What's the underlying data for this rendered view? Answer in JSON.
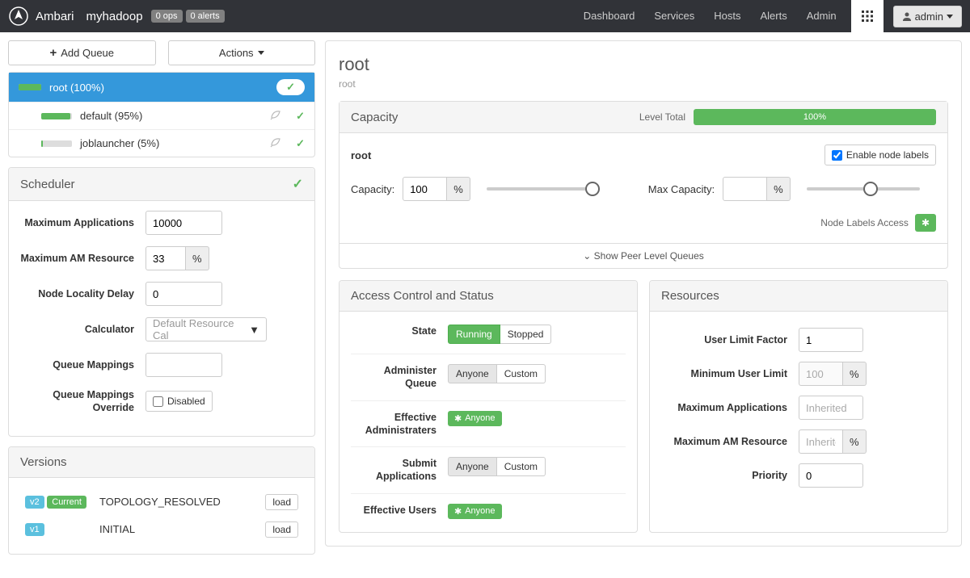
{
  "topnav": {
    "brand": "Ambari",
    "cluster": "myhadoop",
    "ops_badge": "0 ops",
    "alerts_badge": "0 alerts",
    "links": [
      "Dashboard",
      "Services",
      "Hosts",
      "Alerts",
      "Admin"
    ],
    "admin_btn": "admin"
  },
  "sidebar": {
    "add_queue": "Add Queue",
    "actions": "Actions",
    "queues": [
      {
        "label": "root (100%)",
        "fill": 100,
        "barw": 28,
        "indent": 0,
        "selected": true,
        "leaf": false
      },
      {
        "label": "default (95%)",
        "fill": 95,
        "barw": 38,
        "indent": 28,
        "selected": false,
        "leaf": true
      },
      {
        "label": "joblauncher (5%)",
        "fill": 5,
        "barw": 38,
        "indent": 28,
        "selected": false,
        "leaf": true
      }
    ]
  },
  "scheduler": {
    "title": "Scheduler",
    "max_apps_label": "Maximum Applications",
    "max_apps": "10000",
    "max_am_label": "Maximum AM Resource",
    "max_am": "33",
    "locality_label": "Node Locality Delay",
    "locality": "0",
    "calc_label": "Calculator",
    "calc": "Default Resource Cal",
    "qm_label": "Queue Mappings",
    "qm": "",
    "qmo_label": "Queue Mappings Override",
    "qmo": "Disabled"
  },
  "versions": {
    "title": "Versions",
    "rows": [
      {
        "tag": "v2",
        "current": "Current",
        "name": "TOPOLOGY_RESOLVED",
        "btn": "load"
      },
      {
        "tag": "v1",
        "current": "",
        "name": "INITIAL",
        "btn": "load"
      }
    ]
  },
  "main": {
    "title": "root",
    "breadcrumb": "root",
    "capacity": {
      "heading": "Capacity",
      "level_total_label": "Level Total",
      "level_total_pct": "100%",
      "queue_name": "root",
      "enable_labels": "Enable node labels",
      "cap_label": "Capacity:",
      "cap_val": "100",
      "maxcap_label": "Max Capacity:",
      "maxcap_val": "",
      "node_access": "Node Labels Access",
      "peer": "Show Peer Level Queues"
    },
    "acs": {
      "heading": "Access Control and Status",
      "state_label": "State",
      "state_running": "Running",
      "state_stopped": "Stopped",
      "admin_q_label": "Administer Queue",
      "anyone": "Anyone",
      "custom": "Custom",
      "eff_admin_label": "Effective Administraters",
      "anyone_tag": "Anyone",
      "submit_label": "Submit Applications",
      "eff_users_label": "Effective Users"
    },
    "res": {
      "heading": "Resources",
      "ulf_label": "User Limit Factor",
      "ulf": "1",
      "mul_label": "Minimum User Limit",
      "mul": "100",
      "maxapp_label": "Maximum Applications",
      "maxapp_ph": "Inherited",
      "maxam_label": "Maximum AM Resource",
      "maxam_ph": "Inherite",
      "prio_label": "Priority",
      "prio": "0"
    }
  }
}
